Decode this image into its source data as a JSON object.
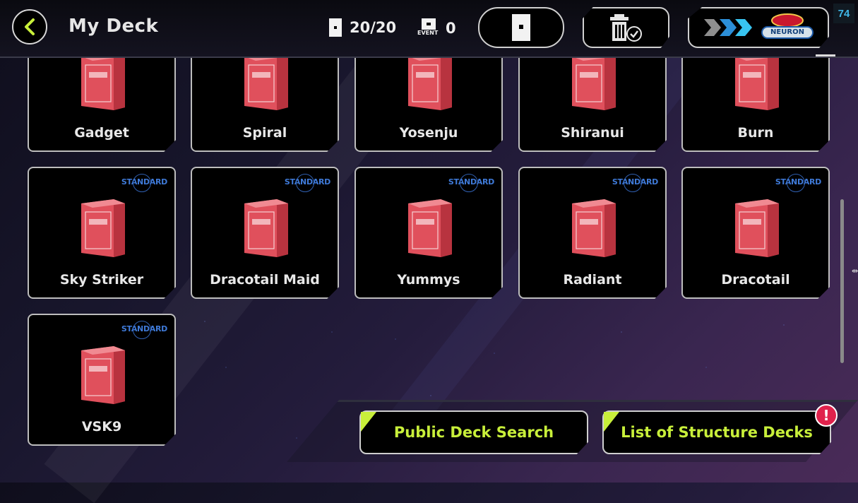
{
  "header": {
    "title": "My Deck",
    "deck_count": "20/20",
    "event_label": "EVENT",
    "event_count": "0",
    "fps": "74",
    "neuron_label": "NEURON"
  },
  "decks": [
    {
      "name": "Gadget",
      "badge": ""
    },
    {
      "name": "Spiral",
      "badge": ""
    },
    {
      "name": "Yosenju",
      "badge": ""
    },
    {
      "name": "Shiranui",
      "badge": ""
    },
    {
      "name": "Burn",
      "badge": ""
    },
    {
      "name": "Sky Striker",
      "badge": "STANDARD"
    },
    {
      "name": "Dracotail Maid",
      "badge": "STANDARD"
    },
    {
      "name": "Yummys",
      "badge": "STANDARD"
    },
    {
      "name": "Radiant",
      "badge": "STANDARD"
    },
    {
      "name": "Dracotail",
      "badge": "STANDARD"
    },
    {
      "name": "VSK9",
      "badge": "STANDARD"
    }
  ],
  "buttons": {
    "public_deck_search": "Public Deck Search",
    "structure_decks": "List of Structure Decks",
    "alert": "!"
  },
  "colors": {
    "accent": "#c8ef3a",
    "deck_box": "#e0505c",
    "badge": "#3f7ad8",
    "alert": "#e0224c"
  }
}
